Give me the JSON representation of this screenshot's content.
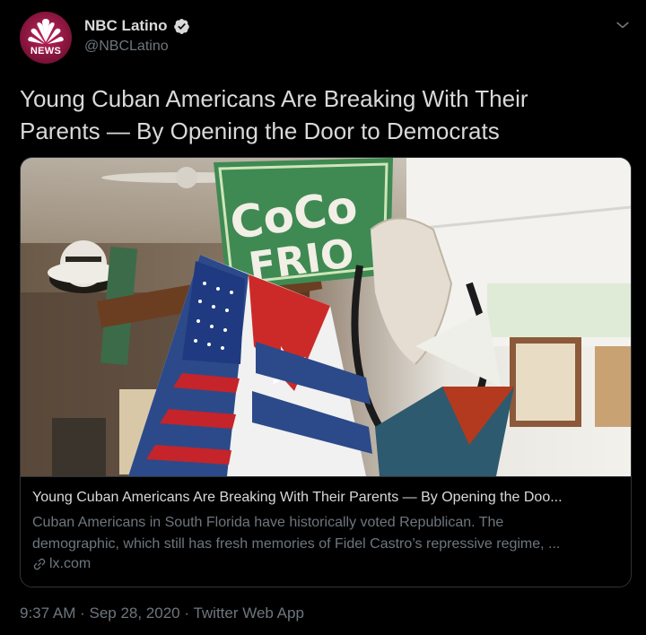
{
  "account": {
    "display_name": "NBC Latino",
    "handle": "@NBCLatino",
    "avatar_text": "NEWS",
    "verified": true
  },
  "tweet": {
    "text_line1": "Young Cuban Americans Are Breaking With Their",
    "text_line2": "Parents — By Opening the Door to Democrats"
  },
  "card": {
    "image_sign_text_1": "CoCo",
    "image_sign_text_2": "FRIO",
    "title": "Young Cuban Americans Are Breaking With Their Parents — By Opening the Doo...",
    "description_line1": "Cuban Americans in South Florida have historically voted Republican. The",
    "description_line2": "demographic, which still has fresh memories of Fidel Castro’s repressive regime, ...",
    "domain": "lx.com"
  },
  "footer": {
    "time": "9:37 AM",
    "date": "Sep 28, 2020",
    "source": "Twitter Web App",
    "separator": " · "
  },
  "colors": {
    "background": "#000000",
    "primary_text": "#d9d9d9",
    "secondary_text": "#6e767d",
    "border": "#2f3336",
    "avatar": "#c2265e"
  },
  "icons": [
    "nbc-peacock-icon",
    "verified-badge-icon",
    "chevron-down-icon",
    "link-icon"
  ]
}
